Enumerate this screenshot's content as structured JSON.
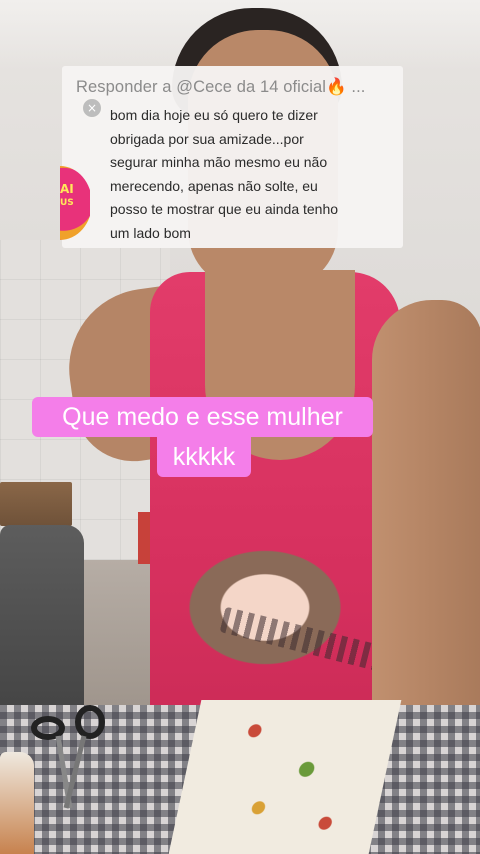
{
  "reply": {
    "prefix": "Responder a @Cece da 14 oficial",
    "emoji": "🔥",
    "ellipsis": " ...",
    "avatar_text_line1": "AI",
    "avatar_text_line2": "US",
    "close_icon": "×",
    "lines": [
      "bom dia hoje eu só quero te dizer",
      "obrigada por sua amizade...por",
      "segurar minha mão mesmo eu não",
      "merecendo,  apenas não solte, eu",
      "posso te mostrar que eu ainda tenho",
      "um lado bom"
    ]
  },
  "caption": {
    "line1": "Que medo e esse mulher",
    "line2": "kkkkk"
  },
  "colors": {
    "caption_bg": "#f47ee9",
    "caption_text": "#ffffff",
    "reply_bg": "#f6f4f2",
    "reply_header_text": "#8b8b8b",
    "reply_body_text": "#2b2b2b"
  }
}
